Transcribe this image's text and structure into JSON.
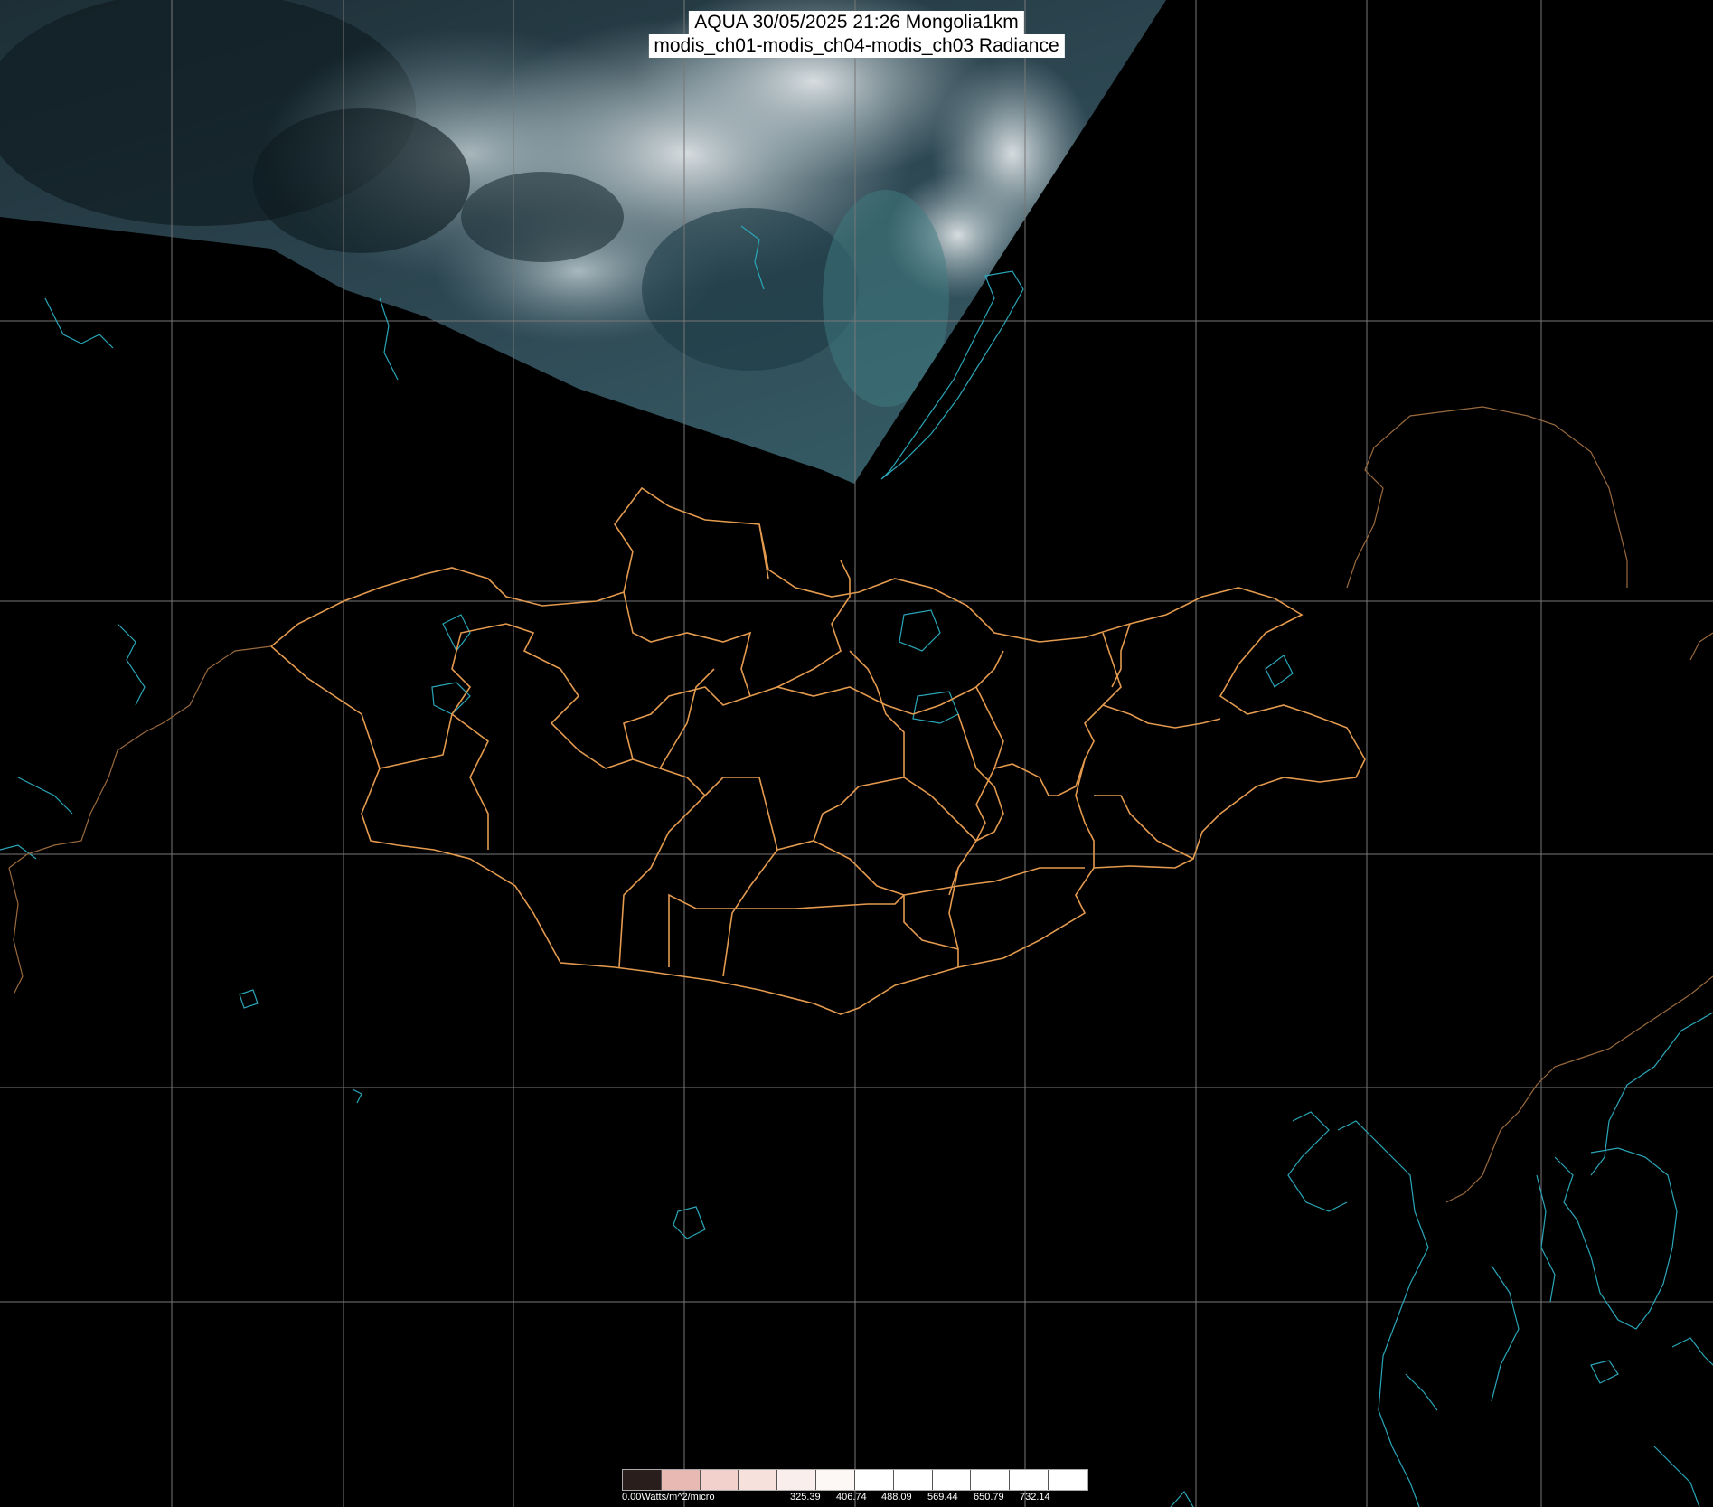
{
  "header": {
    "title_line1": "AQUA 30/05/2025 21:26 Mongolia1km",
    "title_line2": "modis_ch01-modis_ch04-modis_ch03 Radiance"
  },
  "legend": {
    "unit_label": "0.00Watts/m^2/micro",
    "ticks": [
      "325.39",
      "406.74",
      "488.09",
      "569.44",
      "650.79",
      "732.14"
    ]
  },
  "colors": {
    "border": "#e39a4e",
    "coast": "#2aa6b8",
    "grid": "#777777",
    "background": "#000000"
  }
}
